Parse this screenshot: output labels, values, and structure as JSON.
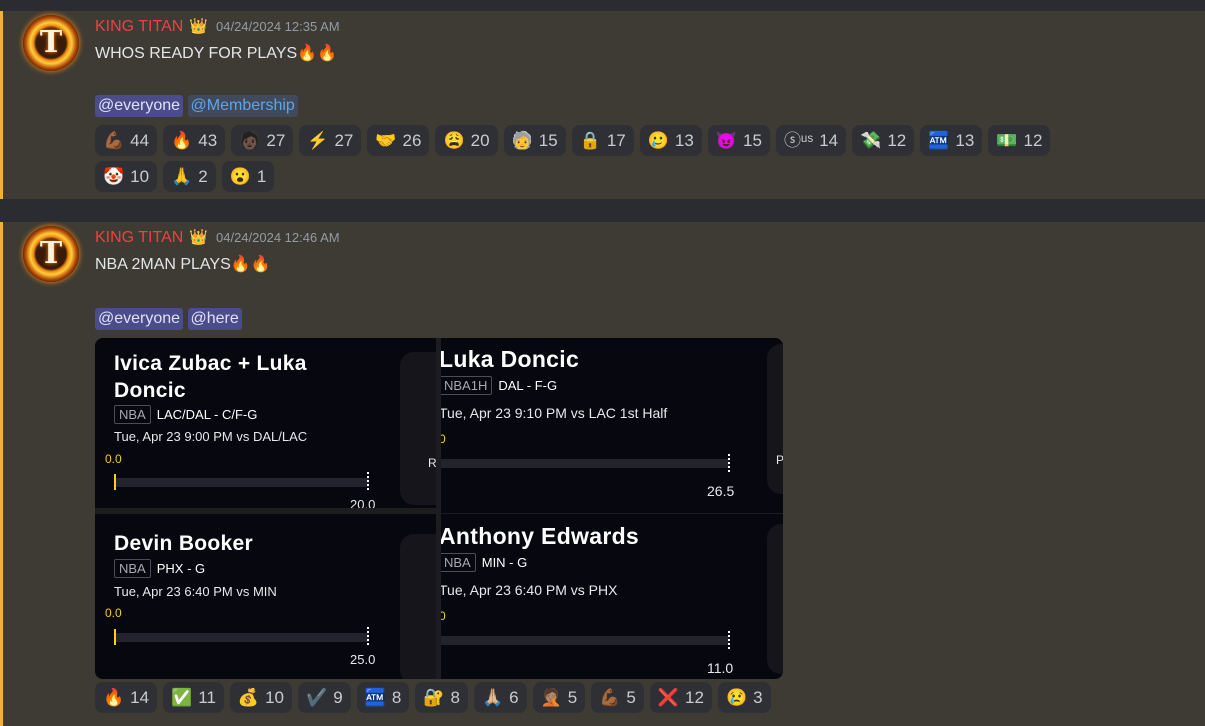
{
  "messages": [
    {
      "author": "KING TITAN",
      "badge_icon": "crown",
      "timestamp": "04/24/2024 12:35 AM",
      "text": "WHOS READY FOR  PLAYS🔥🔥",
      "mentions": [
        "@everyone",
        "@Membership"
      ],
      "reactions": [
        {
          "emoji": "💪🏾",
          "count": "44"
        },
        {
          "emoji": "🔥",
          "count": "43"
        },
        {
          "emoji": "🧑🏿",
          "count": "27"
        },
        {
          "emoji": "⚡",
          "count": "27"
        },
        {
          "emoji": "🤝",
          "count": "26"
        },
        {
          "emoji": "😩",
          "count": "20"
        },
        {
          "emoji": "🧓",
          "count": "15"
        },
        {
          "emoji": "🔒",
          "count": "17"
        },
        {
          "emoji": "🥲",
          "count": "13"
        },
        {
          "emoji": "😈",
          "count": "15"
        },
        {
          "emoji": "ⓢᵘˢ",
          "count": "14"
        },
        {
          "emoji": "💸",
          "count": "12"
        },
        {
          "emoji": "🏧",
          "count": "13"
        },
        {
          "emoji": "💵",
          "count": "12"
        },
        {
          "emoji": "🤡",
          "count": "10"
        },
        {
          "emoji": "🙏",
          "count": "2"
        },
        {
          "emoji": "😮",
          "count": "1"
        }
      ]
    },
    {
      "author": "KING TITAN",
      "badge_icon": "crown",
      "timestamp": "04/24/2024 12:46 AM",
      "text": "NBA 2MAN PLAYS🔥🔥",
      "mentions": [
        "@everyone",
        "@here"
      ],
      "cards": [
        {
          "name": "Ivica Zubac + Luka Doncic",
          "league": "NBA",
          "team_pos": "LAC/DAL - C/F-G",
          "time": "Tue, Apr 23 9:00 PM  vs DAL/LAC",
          "current": "0.0",
          "target": "20.0",
          "side_letter": "R"
        },
        {
          "name": "Luka Doncic",
          "league": "NBA1H",
          "team_pos": "DAL - F-G",
          "time": "Tue, Apr 23 9:10 PM  vs LAC 1st Half",
          "current": "0",
          "target": "26.5",
          "side_letter": "P"
        },
        {
          "name": "Devin Booker",
          "league": "NBA",
          "team_pos": "PHX - G",
          "time": "Tue, Apr 23 6:40 PM  vs MIN",
          "current": "0.0",
          "target": "25.0",
          "side_letter": ""
        },
        {
          "name": "Anthony Edwards",
          "league": "NBA",
          "team_pos": "MIN - G",
          "time": "Tue, Apr 23 6:40 PM  vs PHX",
          "current": "0",
          "target": "11.0",
          "side_letter": ""
        }
      ],
      "reactions": [
        {
          "emoji": "🔥",
          "count": "14"
        },
        {
          "emoji": "✅",
          "count": "11"
        },
        {
          "emoji": "💰",
          "count": "10"
        },
        {
          "emoji": "✔️",
          "count": "9"
        },
        {
          "emoji": "🏧",
          "count": "8"
        },
        {
          "emoji": "🔐",
          "count": "8"
        },
        {
          "emoji": "🙏🏼",
          "count": "6"
        },
        {
          "emoji": "🤦🏽",
          "count": "5"
        },
        {
          "emoji": "💪🏾",
          "count": "5"
        },
        {
          "emoji": "❌",
          "count": "12"
        },
        {
          "emoji": "😢",
          "count": "3"
        }
      ]
    }
  ],
  "colors": {
    "author": "#f23f43",
    "accent_bar": "#f0b232",
    "progress_marker": "#f5d020"
  }
}
